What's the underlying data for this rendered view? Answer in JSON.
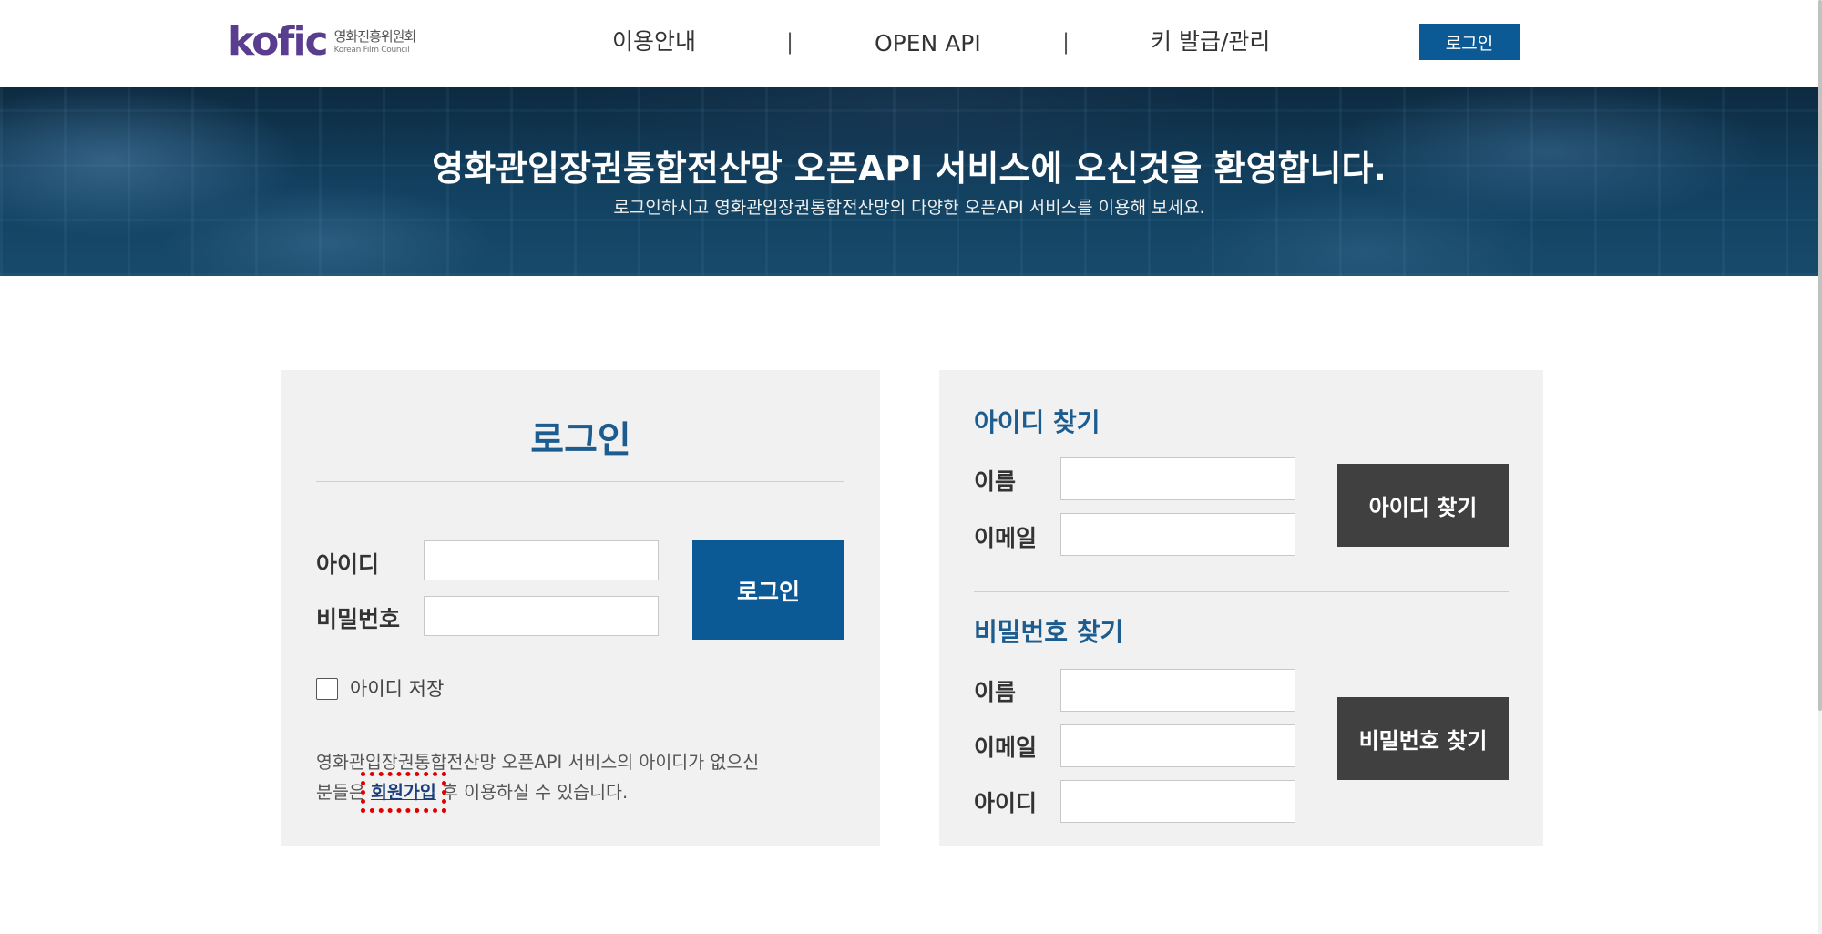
{
  "header": {
    "logo_mark": "kofic",
    "logo_kr": "영화진흥위원회",
    "logo_en": "Korean Film Council",
    "nav": [
      "이용안내",
      "OPEN API",
      "키 발급/관리"
    ],
    "separator": "|",
    "login_button": "로그인"
  },
  "banner": {
    "title": "영화관입장권통합전산망 오픈API 서비스에 오신것을 환영합니다.",
    "subtitle": "로그인하시고 영화관입장권통합전산망의 다양한 오픈API 서비스를 이용해 보세요."
  },
  "login": {
    "title": "로그인",
    "id_label": "아이디",
    "password_label": "비밀번호",
    "id_value": "",
    "password_value": "",
    "submit_label": "로그인",
    "save_id_label": "아이디 저장",
    "save_id_checked": false,
    "info_line1": "영화관입장권통합전산망 오픈API 서비스의 아이디가 없으신",
    "info_line2_before": "분들은 ",
    "signup_link": "회원가입",
    "info_line2_after": " 후 이용하실 수 있습니다."
  },
  "find_id": {
    "title": "아이디 찾기",
    "name_label": "이름",
    "email_label": "이메일",
    "name_value": "",
    "email_value": "",
    "button_label": "아이디 찾기"
  },
  "find_password": {
    "title": "비밀번호 찾기",
    "name_label": "이름",
    "email_label": "이메일",
    "id_label": "아이디",
    "name_value": "",
    "email_value": "",
    "id_value": "",
    "button_label": "비밀번호 찾기"
  },
  "colors": {
    "primary": "#0b5a96",
    "heading": "#1c5c8f",
    "dark_button": "#404040",
    "panel_bg": "#f1f1f1",
    "highlight": "#e00000",
    "logo_purple": "#5b3d8f",
    "logo_orange": "#f39a2b"
  }
}
